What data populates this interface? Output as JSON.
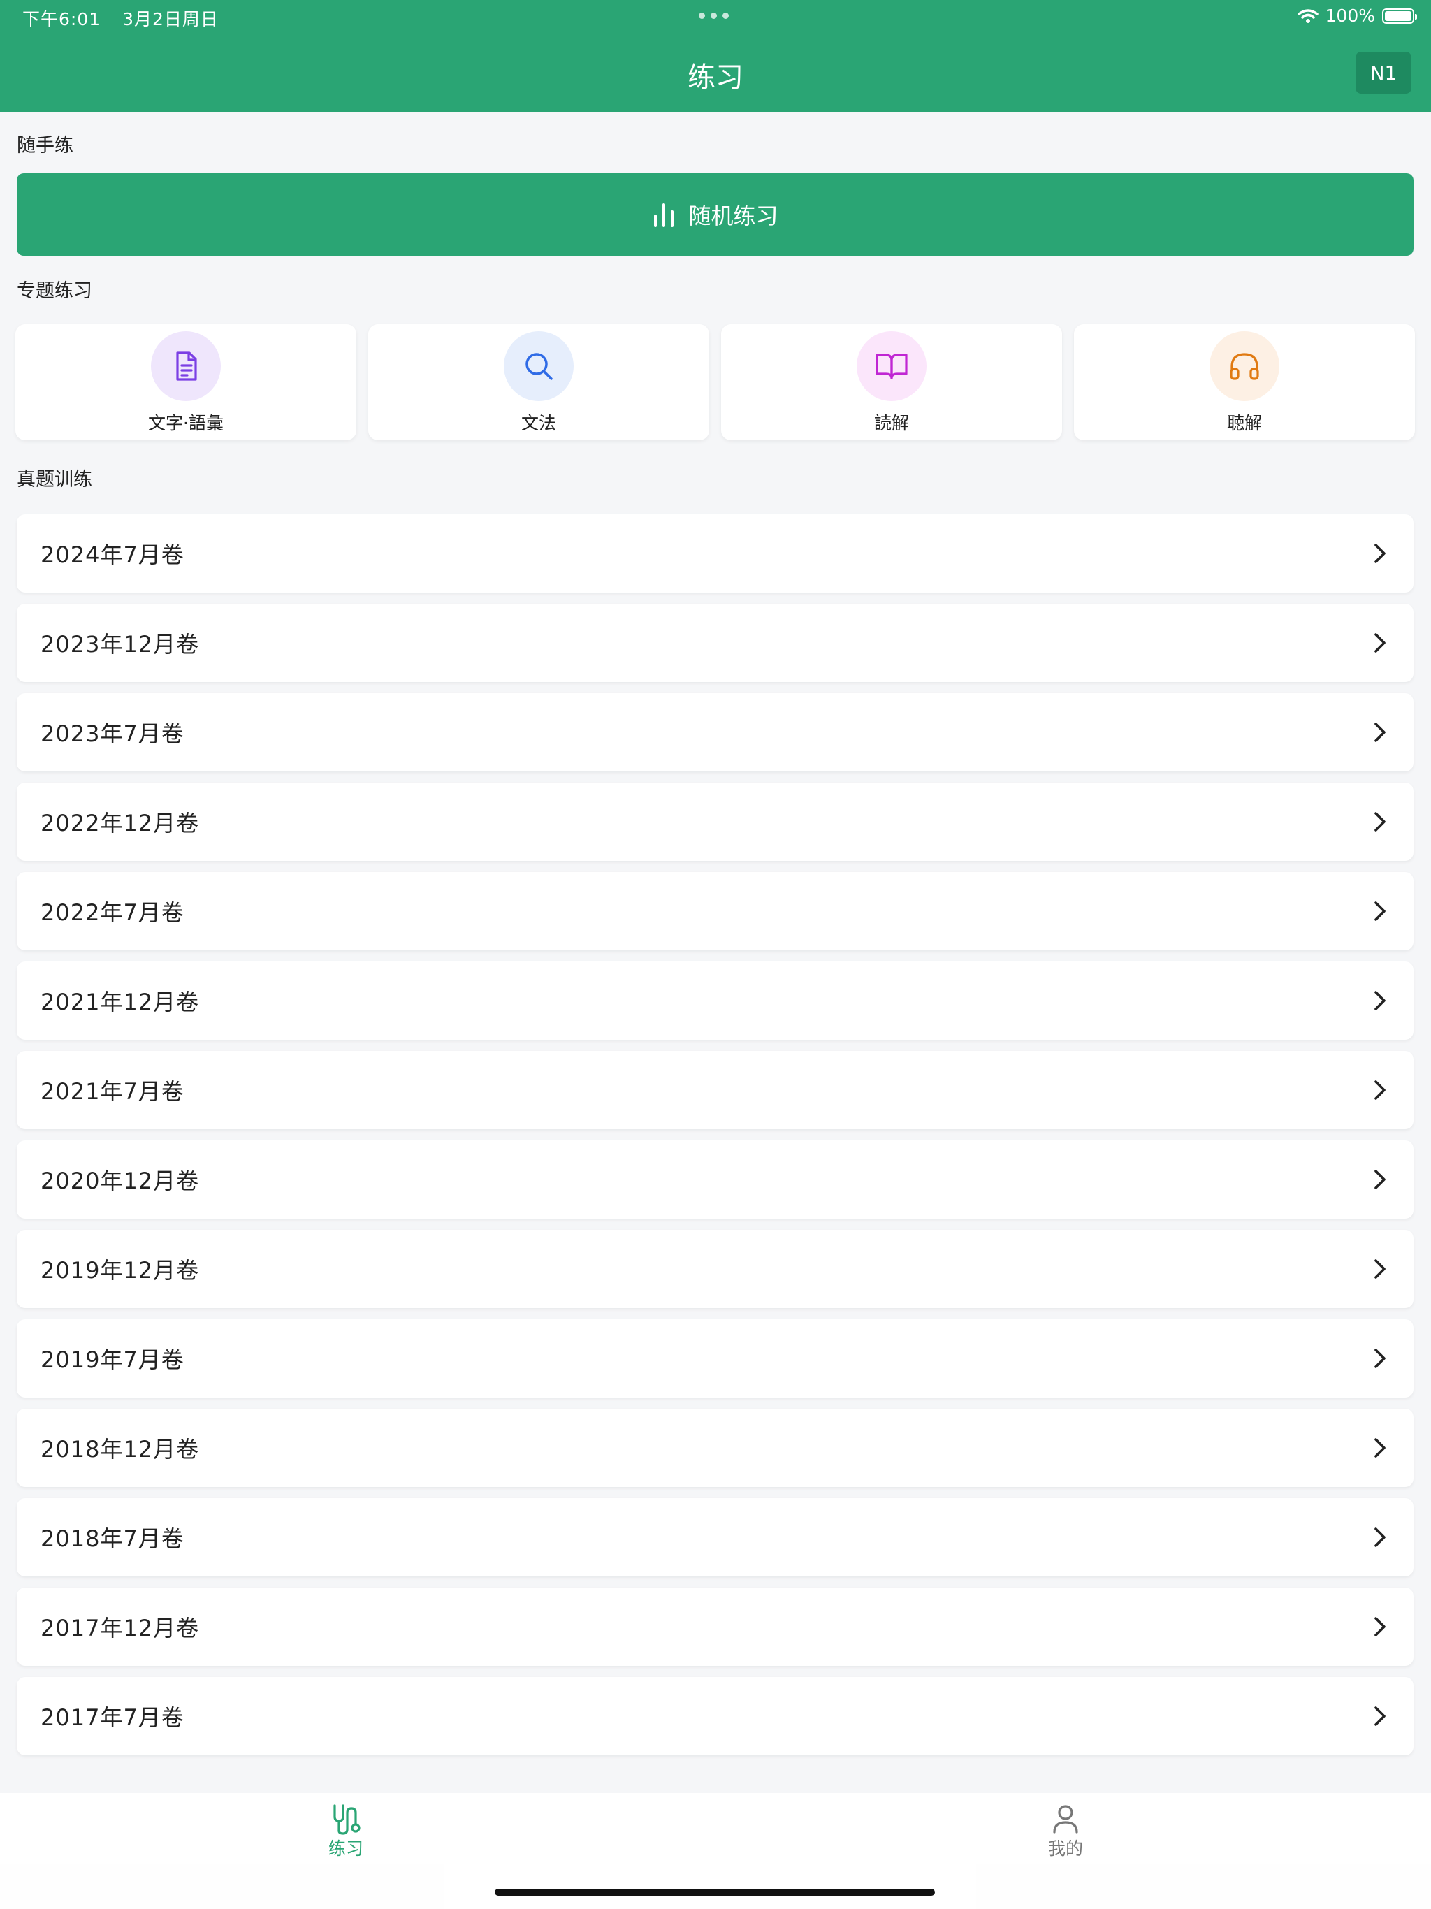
{
  "status_bar": {
    "time": "下午6:01",
    "date": "3月2日周日",
    "battery": "100%"
  },
  "header": {
    "title": "练习",
    "level": "N1"
  },
  "random_section": {
    "label": "随手练",
    "button": "随机练习"
  },
  "topic_section": {
    "label": "专题练习",
    "items": [
      {
        "label": "文字·語彙",
        "icon": "document-icon",
        "color": "#7b3fe4",
        "bg": "#efe6fc"
      },
      {
        "label": "文法",
        "icon": "search-icon",
        "color": "#2f6be6",
        "bg": "#e6eefc"
      },
      {
        "label": "読解",
        "icon": "book-icon",
        "color": "#c026d3",
        "bg": "#fbe6fb"
      },
      {
        "label": "聴解",
        "icon": "headphones-icon",
        "color": "#e07a12",
        "bg": "#fdf0e4"
      }
    ]
  },
  "exam_section": {
    "label": "真题训练",
    "items": [
      "2024年7月卷",
      "2023年12月卷",
      "2023年7月卷",
      "2022年12月卷",
      "2022年7月卷",
      "2021年12月卷",
      "2021年7月卷",
      "2020年12月卷",
      "2019年12月卷",
      "2019年7月卷",
      "2018年12月卷",
      "2018年7月卷",
      "2017年12月卷",
      "2017年7月卷"
    ]
  },
  "tabbar": {
    "practice": "练习",
    "mine": "我的"
  },
  "colors": {
    "primary": "#2aa574"
  }
}
